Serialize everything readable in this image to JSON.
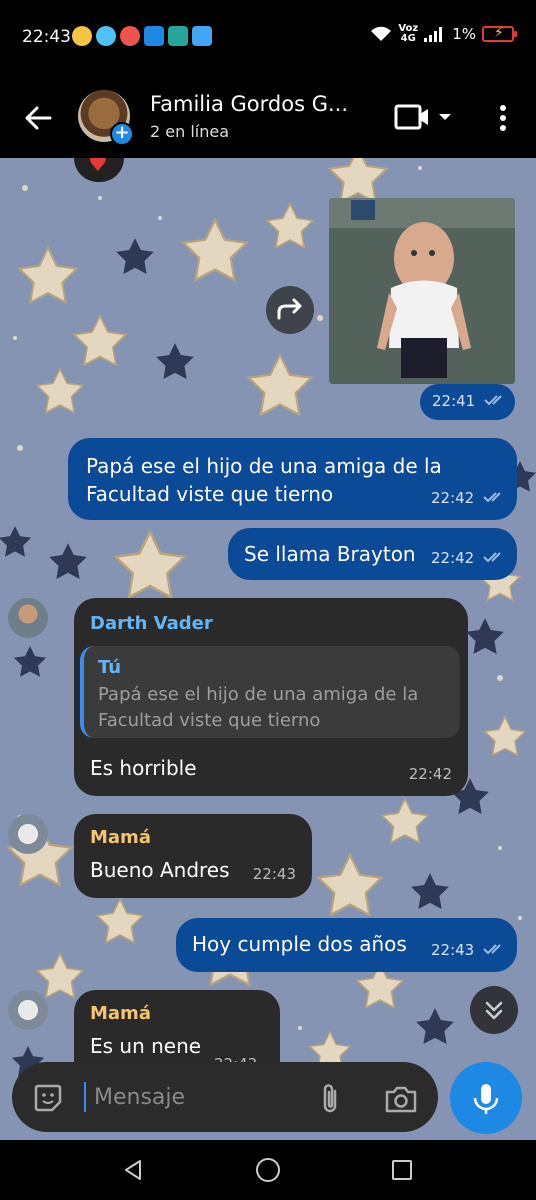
{
  "status_bar": {
    "time": "22:43",
    "network_label_top": "Voz",
    "network_label_bottom": "4G",
    "battery": "1%"
  },
  "header": {
    "title": "Familia Gordos G...",
    "subtitle": "2 en línea"
  },
  "messages": {
    "photo_time": "22:41",
    "m1": {
      "text": "Papá ese el hijo de una amiga de la Facultad viste que tierno",
      "time": "22:42"
    },
    "m2": {
      "text": "Se llama Brayton",
      "time": "22:42"
    },
    "m3": {
      "sender": "Darth Vader",
      "quote_name": "Tú",
      "quote_text": "Papá ese el hijo de una amiga de la Facultad viste que tierno",
      "text": "Es horrible",
      "time": "22:42"
    },
    "m4": {
      "sender": "Mamá",
      "text": "Bueno Andres",
      "time": "22:43"
    },
    "m5": {
      "text": "Hoy cumple dos años",
      "time": "22:43"
    },
    "m6": {
      "sender": "Mamá",
      "text": "Es un nene",
      "time": "22:43"
    }
  },
  "input": {
    "placeholder": "Mensaje"
  },
  "colors": {
    "outgoing_bubble": "#0b4a96",
    "incoming_bubble": "#2a2a2a",
    "chat_background": "#8494b2",
    "accent": "#1e88e5",
    "sender_darth": "#64b5f6",
    "sender_mama": "#f4c56a"
  },
  "icons": [
    "back-arrow-icon",
    "video-call-icon",
    "chevron-down-icon",
    "more-vert-icon",
    "forward-icon",
    "double-check-icon",
    "scroll-down-icon",
    "sticker-icon",
    "attach-icon",
    "camera-icon",
    "mic-icon"
  ]
}
